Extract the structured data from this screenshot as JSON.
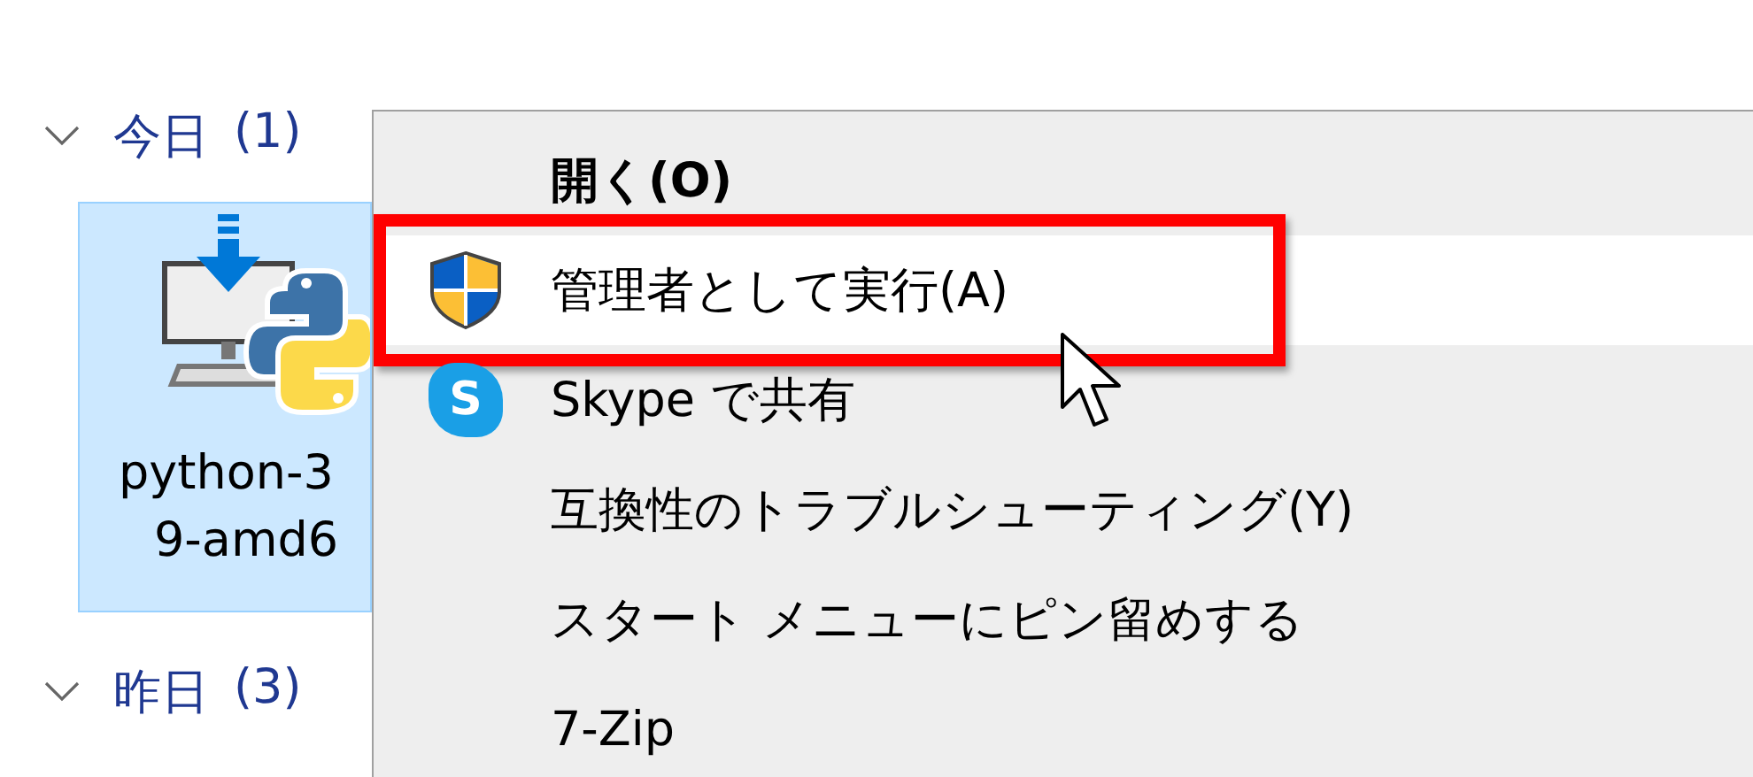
{
  "groups": [
    {
      "label": "今日",
      "count": "(1)",
      "expanded": true,
      "files": [
        {
          "name_lines": [
            "python-3",
            "9-amd6"
          ],
          "selected": true
        }
      ]
    },
    {
      "label": "昨日",
      "count": "(3)",
      "expanded": true
    }
  ],
  "context_menu": {
    "items": [
      {
        "kind": "plain",
        "label": "開く(O)",
        "default": true,
        "highlighted": false,
        "outlined": false
      },
      {
        "kind": "shield",
        "label": "管理者として実行(A)",
        "default": false,
        "highlighted": true,
        "outlined": true
      },
      {
        "kind": "skype",
        "icon_text": "S",
        "label": "Skype で共有",
        "default": false,
        "highlighted": false,
        "outlined": false
      },
      {
        "kind": "plain",
        "label": "互換性のトラブルシューティング(Y)",
        "default": false,
        "highlighted": false,
        "outlined": false
      },
      {
        "kind": "plain",
        "label": "スタート メニューにピン留めする",
        "default": false,
        "highlighted": false,
        "outlined": false
      },
      {
        "kind": "plain",
        "label": "7-Zip",
        "default": false,
        "highlighted": false,
        "outlined": false
      }
    ]
  }
}
